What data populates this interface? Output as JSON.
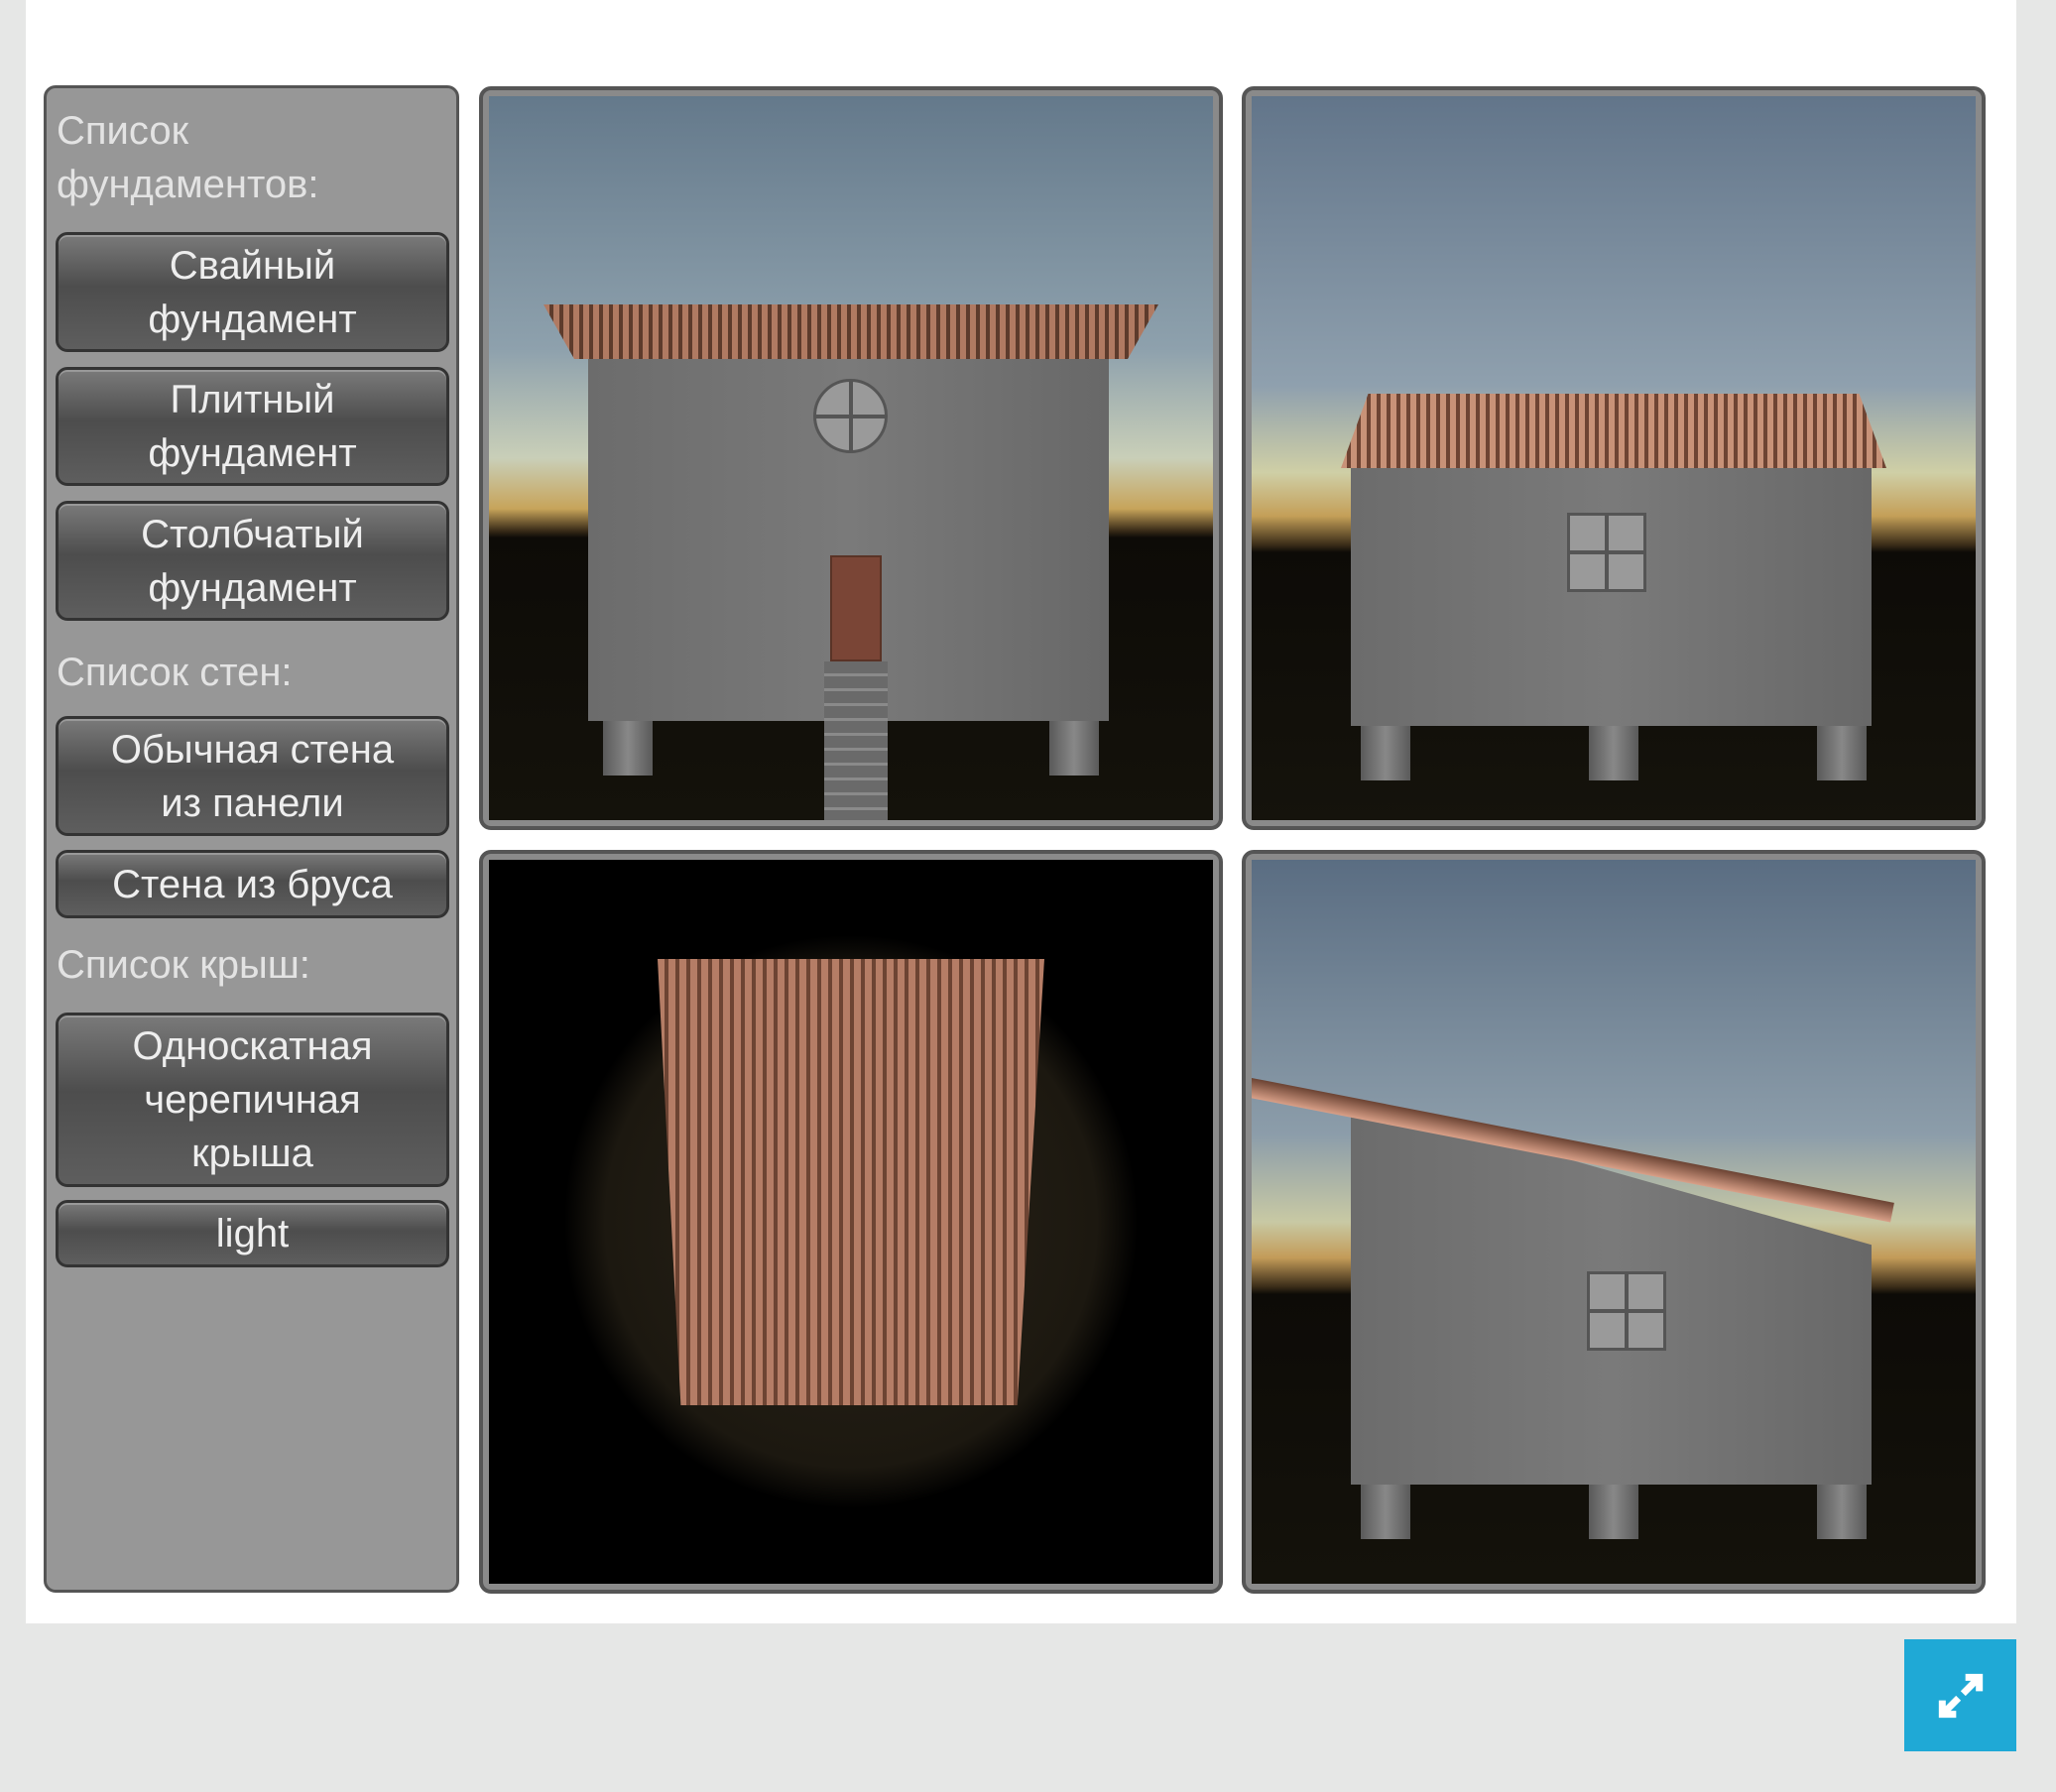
{
  "sidebar": {
    "foundations_label": "Список фундаментов:",
    "foundations": [
      {
        "label": "Свайный\nфундамент"
      },
      {
        "label": "Плитный\nфундамент"
      },
      {
        "label": "Столбчатый\nфундамент"
      }
    ],
    "walls_label": "Список стен:",
    "walls": [
      {
        "label": "Обычная стена\nиз панели"
      },
      {
        "label": "Стена из бруса"
      }
    ],
    "roofs_label": "Список крыш:",
    "roofs": [
      {
        "label": "Односкатная\nчерепичная\nкрыша"
      },
      {
        "label": "light"
      }
    ]
  },
  "views": [
    "front-view",
    "side-view",
    "top-view",
    "perspective-view"
  ],
  "fullscreen": {
    "icon": "expand-arrows-icon",
    "color": "#1fa9d6"
  }
}
